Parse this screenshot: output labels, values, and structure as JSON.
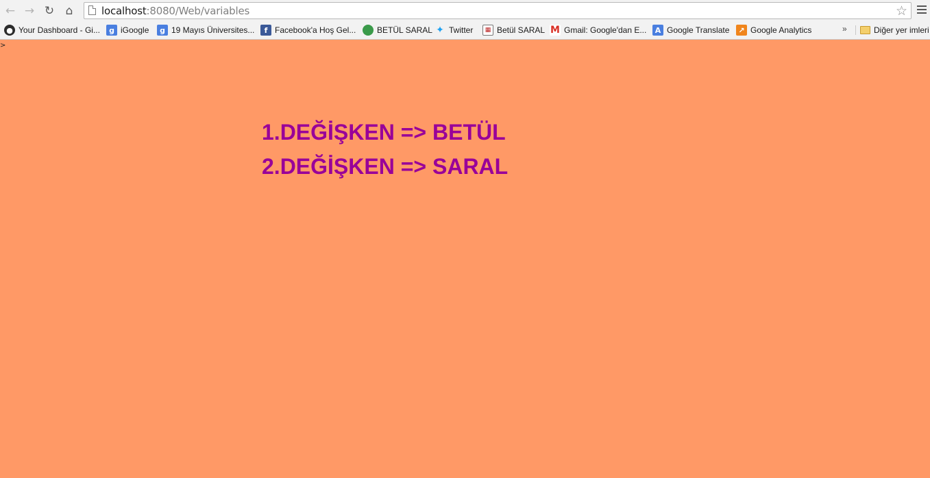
{
  "browser": {
    "url_host": "localhost",
    "url_path": ":8080/Web/variables",
    "bookmarks": [
      {
        "label": "Your Dashboard - Gi...",
        "icon": "github-icon"
      },
      {
        "label": "iGoogle",
        "icon": "google-icon"
      },
      {
        "label": "19 Mayıs Üniversites...",
        "icon": "google-icon"
      },
      {
        "label": "Facebook'a Hoş Gel...",
        "icon": "facebook-icon"
      },
      {
        "label": "BETÜL SARAL",
        "icon": "globe-icon"
      },
      {
        "label": "Twitter",
        "icon": "twitter-icon"
      },
      {
        "label": "Betül SARAL",
        "icon": "blogger-icon"
      },
      {
        "label": "Gmail: Google'dan E...",
        "icon": "gmail-icon"
      },
      {
        "label": "Google Translate",
        "icon": "translate-icon"
      },
      {
        "label": "Google Analytics",
        "icon": "analytics-icon"
      }
    ],
    "more_bookmarks": "»",
    "other_bookmarks": "Diğer yer imleri"
  },
  "page": {
    "background": "#ff9966",
    "text_color": "#990099",
    "stray_text": ">",
    "lines": [
      "1.DEĞİŞKEN => BETÜL",
      "2.DEĞİŞKEN => SARAL"
    ]
  }
}
